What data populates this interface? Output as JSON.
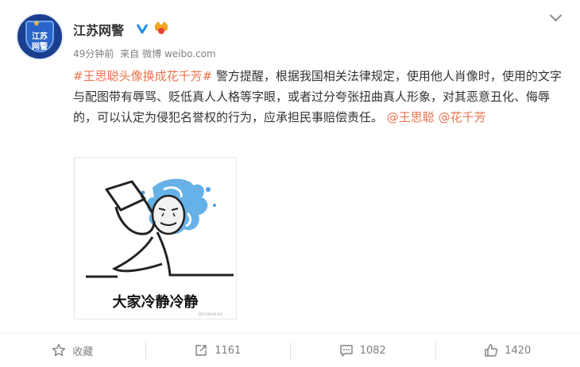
{
  "post": {
    "author": "江苏网警",
    "avatar_text_line1": "江苏",
    "avatar_text_line2": "网警",
    "time": "49分钟前",
    "from_label": "来自",
    "source": "微博 weibo.com",
    "hashtag": "#王思聪头像换成花千芳#",
    "body": " 警方提醒，根据我国相关法律规定，使用他人肖像时，使用的文字与配图带有辱骂、贬低真人人格等字眼，或者过分夸张扭曲真人形象，对其恶意丑化、侮辱的，可以认定为侵犯名誉权的行为，应承担民事赔偿责任。",
    "mentions": [
      "@王思聪",
      "@花千芳"
    ],
    "image_caption": "大家冷静冷静",
    "image_watermark": "@xiaoxiao"
  },
  "actions": {
    "favorite_label": "收藏",
    "repost_count": "1161",
    "comment_count": "1082",
    "like_count": "1420"
  },
  "colors": {
    "link": "#eb7350",
    "verified": "#1d8fe1",
    "meta": "#808080"
  }
}
